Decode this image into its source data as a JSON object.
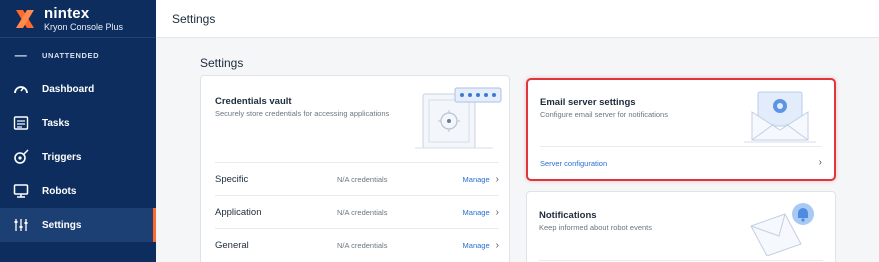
{
  "brand": {
    "name": "nintex",
    "product": "Kryon Console Plus"
  },
  "header": {
    "title": "Settings"
  },
  "sidebar": {
    "group_label": "UNATTENDED",
    "items": [
      {
        "label": "Dashboard",
        "icon": "gauge-icon"
      },
      {
        "label": "Tasks",
        "icon": "tasks-icon"
      },
      {
        "label": "Triggers",
        "icon": "trigger-icon"
      },
      {
        "label": "Robots",
        "icon": "monitor-icon"
      },
      {
        "label": "Settings",
        "icon": "sliders-icon",
        "active": true
      }
    ],
    "active_indicator_color": "#ff6a2c"
  },
  "main": {
    "section_title": "Settings",
    "credentials_vault": {
      "title": "Credentials vault",
      "description": "Securely store credentials for accessing applications",
      "rows": [
        {
          "label": "Specific",
          "count": "N/A credentials",
          "action": "Manage"
        },
        {
          "label": "Application",
          "count": "N/A credentials",
          "action": "Manage"
        },
        {
          "label": "General",
          "count": "N/A credentials",
          "action": "Manage"
        }
      ]
    },
    "email_server": {
      "title": "Email server settings",
      "description": "Configure email server for notifications",
      "link": "Server configuration",
      "highlight_color": "#e0353a"
    },
    "notifications": {
      "title": "Notifications",
      "description": "Keep informed about robot events"
    }
  }
}
